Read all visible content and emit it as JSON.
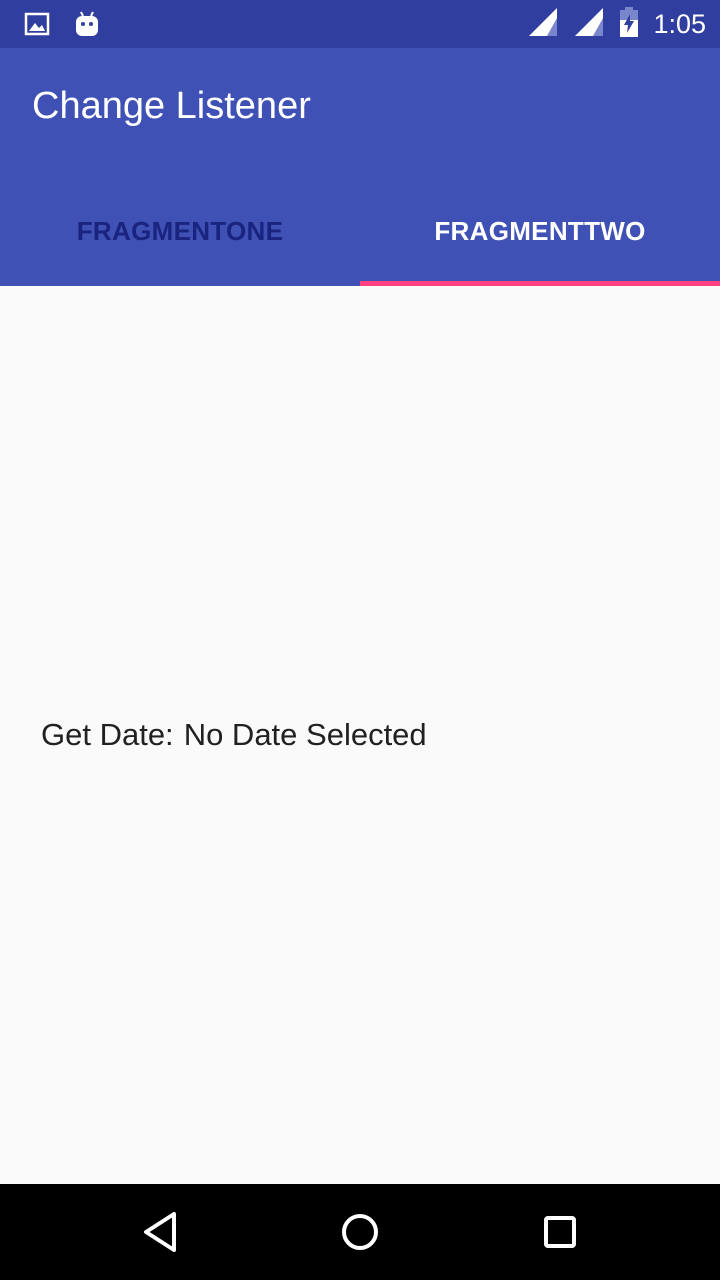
{
  "status_bar": {
    "time": "1:05",
    "left_icons": [
      "image-icon",
      "android-icon"
    ],
    "right_icons": [
      "signal-icon",
      "signal-icon",
      "battery-charging-icon"
    ]
  },
  "app_bar": {
    "title": "Change Listener"
  },
  "tabs": [
    {
      "label": "FRAGMENTONE",
      "selected": false
    },
    {
      "label": "FRAGMENTTWO",
      "selected": true
    }
  ],
  "content": {
    "date_label": "Get Date:",
    "date_value": "No Date Selected"
  },
  "nav_bar": {
    "buttons": [
      "back-icon",
      "home-icon",
      "recents-icon"
    ]
  },
  "colors": {
    "status_bar": "#303F9F",
    "primary": "#3F51B5",
    "accent": "#FF4081",
    "inactive_tab_text": "#1A237E",
    "background": "#FAFAFA"
  }
}
